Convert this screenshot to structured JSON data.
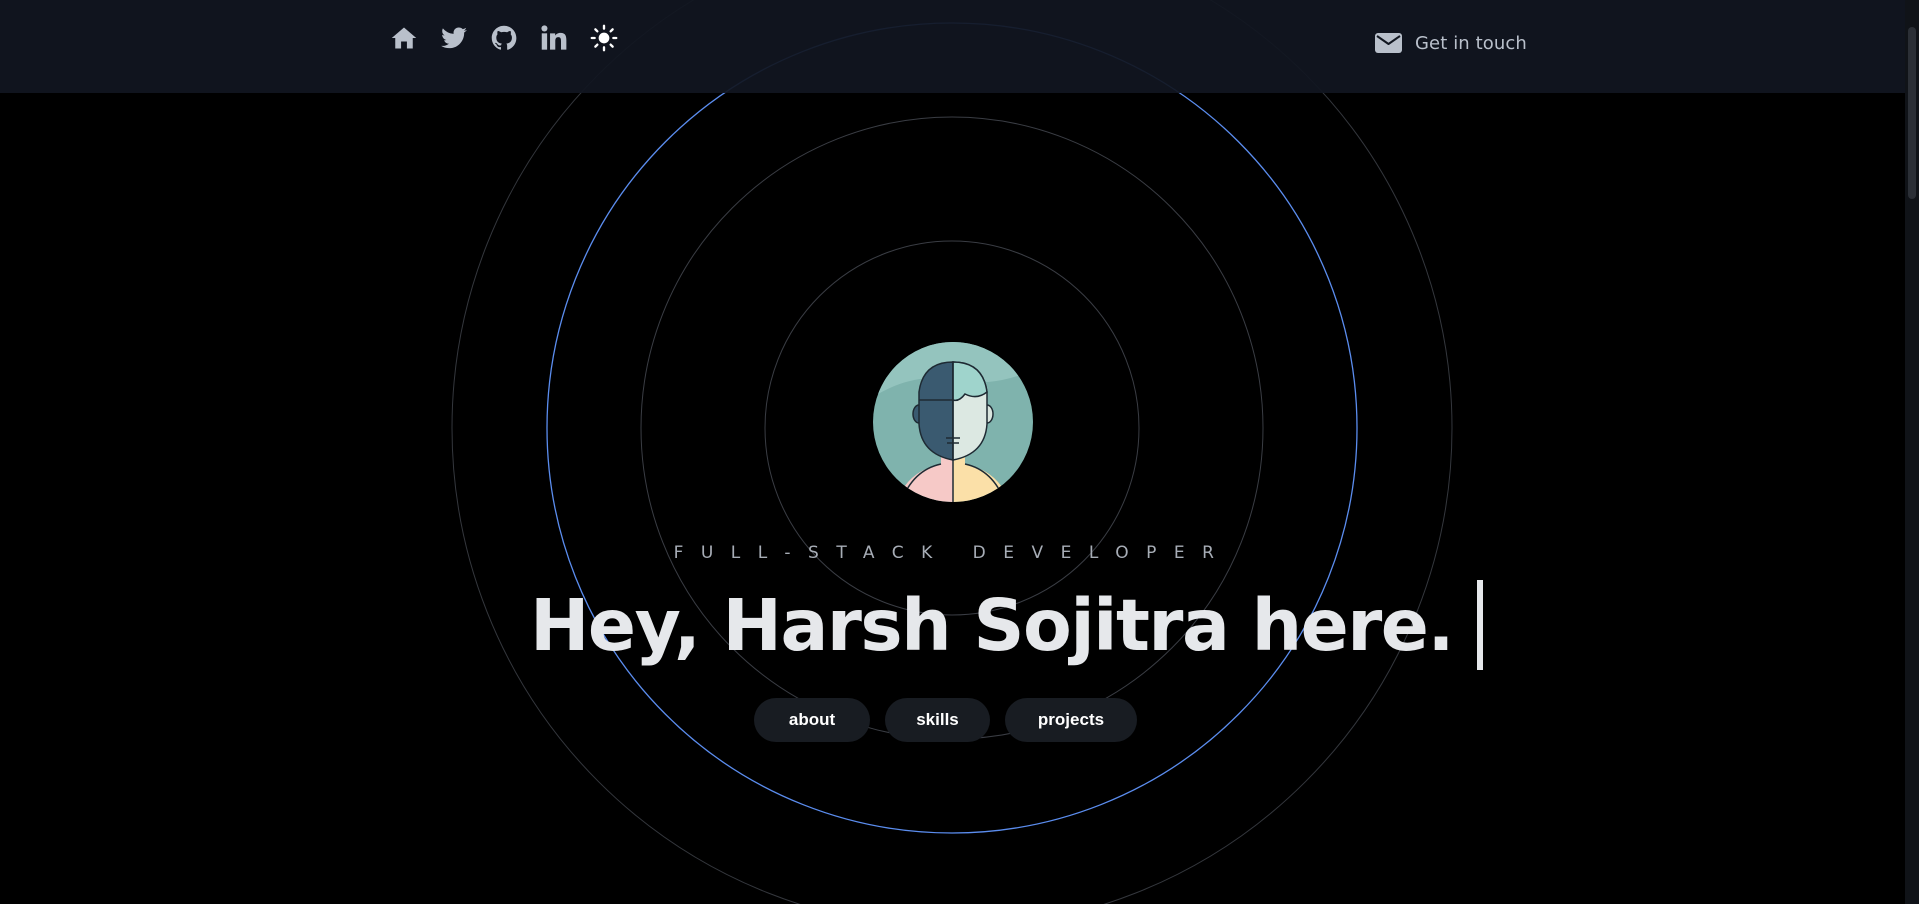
{
  "nav": {
    "icons": [
      "home-icon",
      "twitter-icon",
      "github-icon",
      "linkedin-icon",
      "sun-icon"
    ],
    "contact_label": "Get in touch",
    "contact_icon": "mail-icon"
  },
  "hero": {
    "role": "FULL-STACK DEVELOPER",
    "headline": "Hey, Harsh Sojitra here.",
    "avatar_icon": "avatar-illustration",
    "pills": [
      {
        "label": "about"
      },
      {
        "label": "skills"
      },
      {
        "label": "projects"
      }
    ]
  },
  "colors": {
    "background": "#000000",
    "navbar": "#111620",
    "accent_ring": "#5b8def",
    "ring": "#3a3d44",
    "text": "#e6e8eb",
    "muted": "#a7adb6",
    "pill": "#181c22"
  }
}
